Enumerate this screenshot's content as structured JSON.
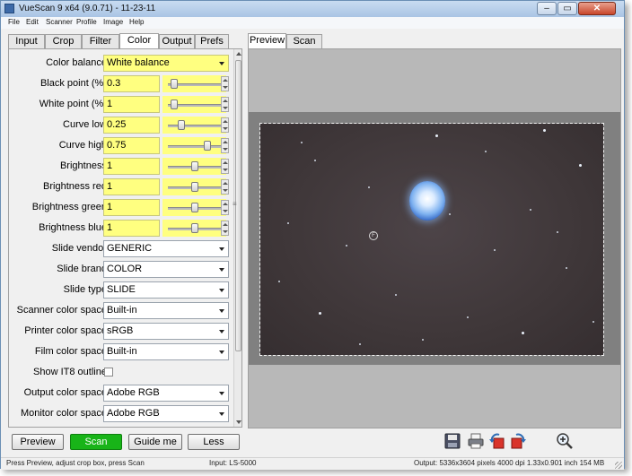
{
  "window": {
    "title": "VueScan 9 x64 (9.0.71) - 11-23-11",
    "controls": {
      "minimize": "–",
      "maximize": "▭",
      "close": "✕"
    }
  },
  "menu": [
    "File",
    "Edit",
    "Scanner",
    "Profile",
    "Image",
    "Help"
  ],
  "left_tabs": [
    {
      "label": "Input",
      "active": false
    },
    {
      "label": "Crop",
      "active": false
    },
    {
      "label": "Filter",
      "active": false
    },
    {
      "label": "Color",
      "active": true
    },
    {
      "label": "Output",
      "active": false
    },
    {
      "label": "Prefs",
      "active": false
    }
  ],
  "right_tabs": [
    {
      "label": "Preview",
      "active": true
    },
    {
      "label": "Scan",
      "active": false
    }
  ],
  "color_settings": {
    "color_balance": {
      "label": "Color balance:",
      "value": "White balance"
    },
    "black_point": {
      "label": "Black point (%):",
      "value": "0.3",
      "slider": 0.05
    },
    "white_point": {
      "label": "White point (%):",
      "value": "1",
      "slider": 0.05
    },
    "curve_low": {
      "label": "Curve low:",
      "value": "0.25",
      "slider": 0.22
    },
    "curve_high": {
      "label": "Curve high:",
      "value": "0.75",
      "slider": 0.78
    },
    "brightness": {
      "label": "Brightness:",
      "value": "1",
      "slider": 0.5
    },
    "brightness_red": {
      "label": "Brightness red:",
      "value": "1",
      "slider": 0.5
    },
    "brightness_green": {
      "label": "Brightness green:",
      "value": "1",
      "slider": 0.5
    },
    "brightness_blue": {
      "label": "Brightness blue:",
      "value": "1",
      "slider": 0.5
    },
    "slide_vendor": {
      "label": "Slide vendor:",
      "value": "GENERIC"
    },
    "slide_brand": {
      "label": "Slide brand:",
      "value": "COLOR"
    },
    "slide_type": {
      "label": "Slide type:",
      "value": "SLIDE"
    },
    "scanner_color_space": {
      "label": "Scanner color space:",
      "value": "Built-in"
    },
    "printer_color_space": {
      "label": "Printer color space:",
      "value": "sRGB"
    },
    "film_color_space": {
      "label": "Film color space:",
      "value": "Built-in"
    },
    "show_it8_outline": {
      "label": "Show IT8 outline:",
      "checked": false
    },
    "output_color_space": {
      "label": "Output color space:",
      "value": "Adobe RGB"
    },
    "monitor_color_space": {
      "label": "Monitor color space:",
      "value": "Adobe RGB"
    }
  },
  "buttons": {
    "preview": "Preview",
    "scan": "Scan",
    "guide": "Guide me",
    "less": "Less"
  },
  "toolbar_icons": [
    "save-icon",
    "print-icon",
    "rotate-left-icon",
    "rotate-right-icon",
    "zoom-in-icon"
  ],
  "status": {
    "hint": "Press Preview, adjust crop box, press Scan",
    "input": "Input: LS-5000",
    "output": "Output: 5336x3604 pixels 4000 dpi 1.33x0.901 inch 154 MB"
  },
  "colors": {
    "highlight": "#ffff80",
    "scan_button": "#18b418",
    "photo_background": "#3f3739"
  }
}
